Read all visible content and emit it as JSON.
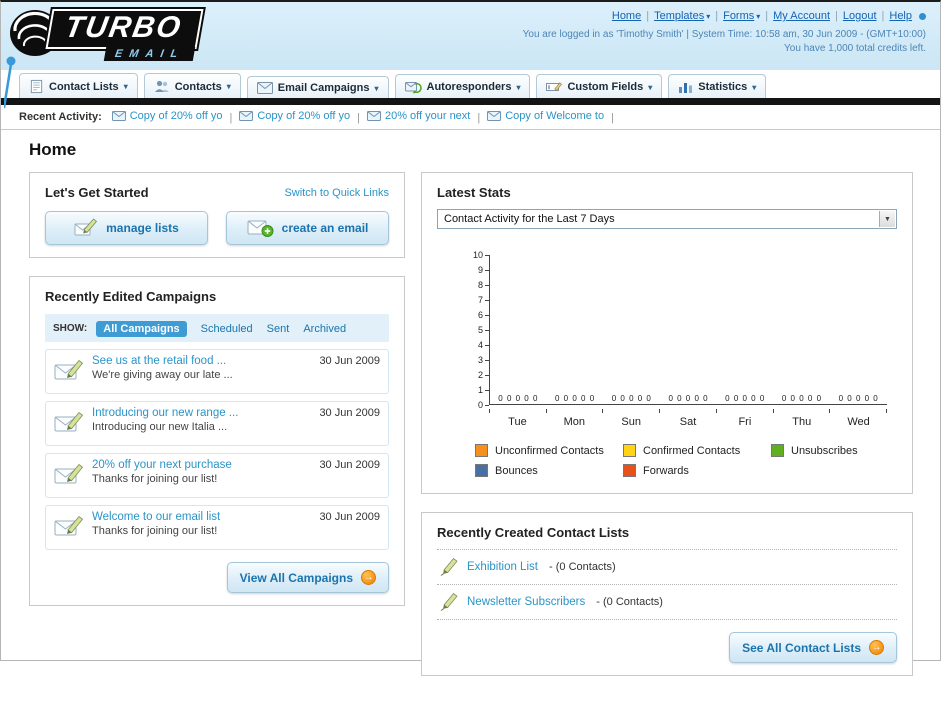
{
  "header": {
    "logo_line1": "TURBO",
    "logo_line2": "EMAIL",
    "links": [
      {
        "label": "Home",
        "dropdown": false
      },
      {
        "label": "Templates",
        "dropdown": true
      },
      {
        "label": "Forms",
        "dropdown": true
      },
      {
        "label": "My Account",
        "dropdown": false
      },
      {
        "label": "Logout",
        "dropdown": false
      },
      {
        "label": "Help",
        "dropdown": false
      }
    ],
    "login_info": "You are logged in as 'Timothy Smith' | System Time: 10:58 am, 30 Jun 2009 - (GMT+10:00)",
    "credits": "You have 1,000 total credits left."
  },
  "nav": {
    "tabs": [
      {
        "label": "Contact Lists",
        "icon": "contact-lists-icon"
      },
      {
        "label": "Contacts",
        "icon": "contacts-icon"
      },
      {
        "label": "Email Campaigns",
        "icon": "email-campaigns-icon"
      },
      {
        "label": "Autoresponders",
        "icon": "autoresponders-icon"
      },
      {
        "label": "Custom Fields",
        "icon": "custom-fields-icon"
      },
      {
        "label": "Statistics",
        "icon": "statistics-icon"
      }
    ]
  },
  "recent_activity": {
    "label": "Recent Activity:",
    "items": [
      {
        "label": "Copy of 20% off yo"
      },
      {
        "label": "Copy of 20% off yo"
      },
      {
        "label": "20% off your next"
      },
      {
        "label": "Copy of Welcome to"
      }
    ]
  },
  "page_title": "Home",
  "get_started": {
    "title": "Let's Get Started",
    "switch_link": "Switch to Quick Links",
    "buttons": [
      {
        "label": "manage lists",
        "icon": "pencil-envelope-icon"
      },
      {
        "label": "create an email",
        "icon": "email-plus-icon"
      }
    ]
  },
  "campaigns": {
    "title": "Recently Edited Campaigns",
    "show_label": "SHOW:",
    "filters": [
      {
        "label": "All Campaigns",
        "selected": true
      },
      {
        "label": "Scheduled",
        "selected": false
      },
      {
        "label": "Sent",
        "selected": false
      },
      {
        "label": "Archived",
        "selected": false
      }
    ],
    "items": [
      {
        "title": "See us at the retail food ...",
        "subtitle": "We're giving away our late ...",
        "date": "30 Jun 2009"
      },
      {
        "title": "Introducing our new range ...",
        "subtitle": "Introducing our new Italia ...",
        "date": "30 Jun 2009"
      },
      {
        "title": "20% off your next purchase",
        "subtitle": "Thanks for joining our list!",
        "date": "30 Jun 2009"
      },
      {
        "title": "Welcome to our email list",
        "subtitle": "Thanks for joining our list!",
        "date": "30 Jun 2009"
      }
    ],
    "view_all_label": "View All Campaigns"
  },
  "stats": {
    "title": "Latest Stats",
    "period_selected": "Contact Activity for the Last 7 Days",
    "chart_data": {
      "type": "bar",
      "title": "Contact Activity for the Last 7 Days",
      "categories": [
        "Tue",
        "Mon",
        "Sun",
        "Sat",
        "Fri",
        "Thu",
        "Wed"
      ],
      "series": [
        {
          "name": "Unconfirmed Contacts",
          "color": "#f78f1e",
          "values": [
            0,
            0,
            0,
            0,
            0,
            0,
            0
          ]
        },
        {
          "name": "Confirmed Contacts",
          "color": "#ffd416",
          "values": [
            0,
            0,
            0,
            0,
            0,
            0,
            0
          ]
        },
        {
          "name": "Unsubscribes",
          "color": "#5faf1e",
          "values": [
            0,
            0,
            0,
            0,
            0,
            0,
            0
          ]
        },
        {
          "name": "Bounces",
          "color": "#4a6fa5",
          "values": [
            0,
            0,
            0,
            0,
            0,
            0,
            0
          ]
        },
        {
          "name": "Forwards",
          "color": "#e8501c",
          "values": [
            0,
            0,
            0,
            0,
            0,
            0,
            0
          ]
        }
      ],
      "ylim": [
        0,
        10
      ],
      "yticks": [
        10,
        9,
        8,
        7,
        6,
        5,
        4,
        3,
        2,
        1,
        0
      ],
      "grid": false,
      "legend_position": "bottom"
    }
  },
  "contact_lists": {
    "title": "Recently Created Contact Lists",
    "items": [
      {
        "name": "Exhibition List",
        "suffix": "- (0 Contacts)"
      },
      {
        "name": "Newsletter Subscribers",
        "suffix": "- (0 Contacts)"
      }
    ],
    "see_all_label": "See All Contact Lists"
  }
}
